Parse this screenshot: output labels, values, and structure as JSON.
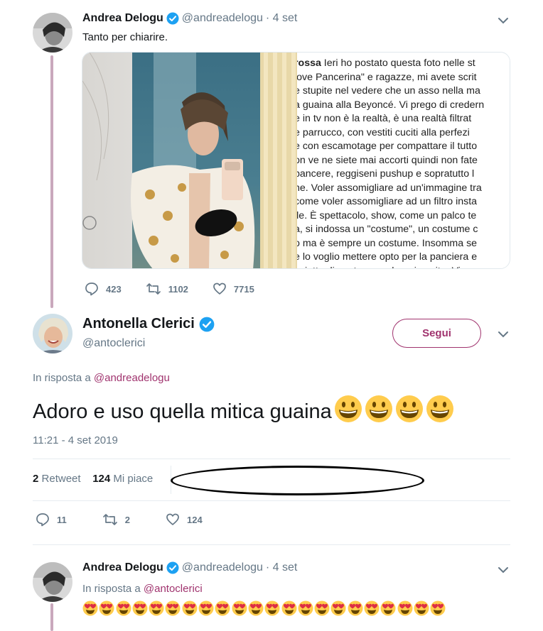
{
  "tweet1": {
    "display_name": "Andrea Delogu",
    "handle": "@andreadelogu",
    "time": "· 4 set",
    "text": "Tanto per chiarire.",
    "card_lines": [
      {
        "bold": "rossa",
        "rest": " Ieri ho postato questa foto nelle st"
      },
      {
        "bold": "",
        "rest": "love Pancerina\" e ragazze, mi avete scrit"
      },
      {
        "bold": "",
        "rest": "e stupite nel vedere che un asso nella ma"
      },
      {
        "bold": "",
        "rest": "a guaina alla Beyoncé. Vi prego di credern"
      },
      {
        "bold": "",
        "rest": "e in tv non è la realtà, è una realtà filtrat"
      },
      {
        "bold": "",
        "rest": "e parrucco, con vestiti cuciti alla perfezi"
      },
      {
        "bold": "",
        "rest": "e con escamotage per compattare il tutto"
      },
      {
        "bold": "",
        "rest": "on ve ne siete mai accorti quindi non fate"
      },
      {
        "bold": "",
        "rest": "pancere, reggiseni pushup e sopratutto l"
      },
      {
        "bold": "",
        "rest": "ne. Voler assomigliare ad un'immagine tra"
      },
      {
        "bold": "",
        "rest": " come voler assomigliare ad un filtro insta"
      },
      {
        "bold": "",
        "rest": "ile. È spettacolo, show, come un palco te"
      },
      {
        "bold": "",
        "rest": "a, si indossa un \"costume\", un costume c"
      },
      {
        "bold": "",
        "rest": "o ma è sempre un costume. Insomma se"
      },
      {
        "bold": "",
        "rest": "e lo voglio mettere opto per la panciera e"
      },
      {
        "bold": "",
        "rest": "l piatto di pasta e so che mi capite. Vi ar"
      }
    ],
    "replies": "423",
    "retweets": "1102",
    "likes": "7715"
  },
  "tweet2": {
    "display_name": "Antonella Clerici",
    "handle": "@antoclerici",
    "follow_label": "Segui",
    "reply_prefix": "In risposta a",
    "reply_mention": "@andreadelogu",
    "text": "Adoro e uso quella mitica guaina",
    "emoji_count": 4,
    "timestamp": "11:21 - 4 set 2019",
    "retweet_count": "2",
    "retweet_label": "Retweet",
    "like_count": "124",
    "like_label": "Mi piace",
    "replies": "11",
    "retweets": "2",
    "likes": "124"
  },
  "tweet3": {
    "display_name": "Andrea Delogu",
    "handle": "@andreadelogu",
    "time": "· 4 set",
    "reply_prefix": "In risposta a",
    "reply_mention": "@antoclerici",
    "emoji_count": 22
  },
  "colors": {
    "accent": "#a0336e",
    "verified": "#1da1f2",
    "muted": "#657786",
    "thread": "#c9a8bc"
  }
}
